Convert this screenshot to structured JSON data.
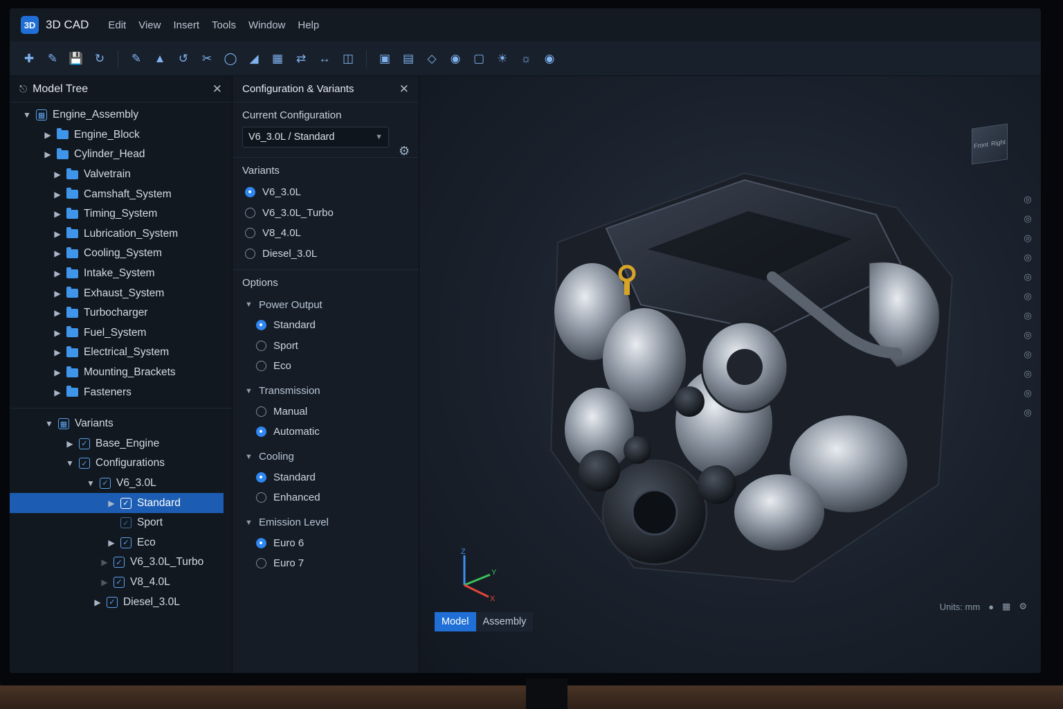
{
  "app": {
    "logo": "3D",
    "name": "3D CAD"
  },
  "menu": [
    "Edit",
    "View",
    "Insert",
    "Tools",
    "Window",
    "Help"
  ],
  "toolbar_icons": [
    "new-file-icon",
    "open-icon",
    "save-icon",
    "refresh-icon",
    "sketch-icon",
    "extrude-icon",
    "revolve-icon",
    "cut-icon",
    "fillet-icon",
    "chamfer-icon",
    "pattern-icon",
    "mirror-icon",
    "measure-icon",
    "section-icon",
    "view-front-icon",
    "view-top-icon",
    "view-iso-icon",
    "shade-icon",
    "wireframe-icon",
    "render-icon",
    "lighting-icon",
    "camera-icon"
  ],
  "tree_panel": {
    "title": "Model Tree",
    "root": "Engine_Assembly",
    "parts": [
      "Engine_Block",
      "Cylinder_Head",
      "Valvetrain",
      "Camshaft_System",
      "Timing_System",
      "Lubrication_System",
      "Cooling_System",
      "Intake_System",
      "Exhaust_System",
      "Turbocharger",
      "Fuel_System",
      "Electrical_System",
      "Mounting_Brackets",
      "Fasteners"
    ],
    "variants_root": "Variants",
    "base": "Base_Engine",
    "configurations": "Configurations",
    "v6": "V6_3.0L",
    "v6_children": [
      "Standard",
      "Sport",
      "Eco"
    ],
    "others": [
      "V6_3.0L_Turbo",
      "V8_4.0L",
      "Diesel_3.0L"
    ]
  },
  "config_panel": {
    "title": "Configuration & Variants",
    "current_label": "Current Configuration",
    "current_value": "V6_3.0L / Standard",
    "variants_label": "Variants",
    "variants": [
      {
        "label": "V6_3.0L",
        "selected": true
      },
      {
        "label": "V6_3.0L_Turbo",
        "selected": false
      },
      {
        "label": "V8_4.0L",
        "selected": false
      },
      {
        "label": "Diesel_3.0L",
        "selected": false
      }
    ],
    "options_label": "Options",
    "groups": [
      {
        "label": "Power Output",
        "options": [
          {
            "label": "Standard",
            "selected": true
          },
          {
            "label": "Sport",
            "selected": false
          },
          {
            "label": "Eco",
            "selected": false
          }
        ]
      },
      {
        "label": "Transmission",
        "options": [
          {
            "label": "Manual",
            "selected": false
          },
          {
            "label": "Automatic",
            "selected": true
          }
        ]
      },
      {
        "label": "Cooling",
        "options": [
          {
            "label": "Standard",
            "selected": true
          },
          {
            "label": "Enhanced",
            "selected": false
          }
        ]
      },
      {
        "label": "Emission Level",
        "options": [
          {
            "label": "Euro 6",
            "selected": true
          },
          {
            "label": "Euro 7",
            "selected": false
          }
        ]
      }
    ]
  },
  "viewport": {
    "cube_faces": [
      "Front",
      "Right"
    ],
    "axes": [
      "Z",
      "Y",
      "X"
    ],
    "units": "Units: mm",
    "tabs": [
      {
        "label": "Model",
        "active": true
      },
      {
        "label": "Assembly",
        "active": false
      }
    ]
  },
  "colors": {
    "accent": "#1f6fd6",
    "folder": "#3f95ea",
    "selection": "#1c5db3",
    "axis_x": "#e2463c",
    "axis_y": "#3fbf5a",
    "axis_z": "#3f8ef0"
  }
}
